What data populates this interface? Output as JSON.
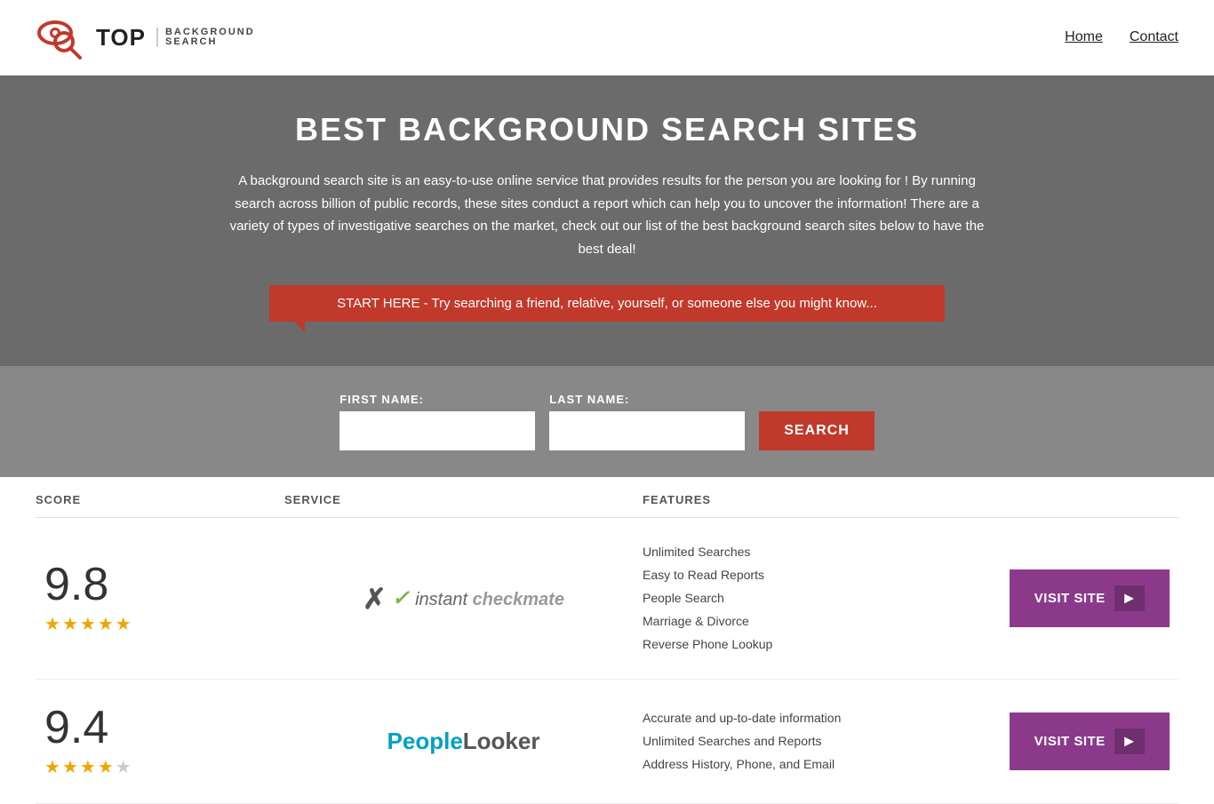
{
  "site": {
    "title": "Top Background Search"
  },
  "header": {
    "logo_top": "TOP",
    "logo_sub1": "BACKGROUND",
    "logo_sub2": "SEARCH",
    "nav": [
      {
        "label": "Home",
        "href": "#"
      },
      {
        "label": "Contact",
        "href": "#"
      }
    ]
  },
  "hero": {
    "title": "BEST BACKGROUND SEARCH SITES",
    "description": "A background search site is an easy-to-use online service that provides results  for the person you are looking for ! By  running  search across billion of public records, these sites conduct  a report which can help you to uncover the information! There are a variety of types of investigative searches on the market, check out our  list of the best background search sites below to have the best deal!",
    "cta_text": "START HERE - Try searching a friend, relative, yourself, or someone else you might know...",
    "first_name_label": "FIRST NAME:",
    "last_name_label": "LAST NAME:",
    "search_button": "SEARCH"
  },
  "table": {
    "headers": {
      "score": "SCORE",
      "service": "SERVICE",
      "features": "FEATURES",
      "action": ""
    },
    "rows": [
      {
        "score": "9.8",
        "stars": 4.5,
        "service_name": "Instant Checkmate",
        "service_type": "checkmate",
        "features": [
          "Unlimited Searches",
          "Easy to Read Reports",
          "People Search",
          "Marriage & Divorce",
          "Reverse Phone Lookup"
        ],
        "visit_label": "VISIT SITE"
      },
      {
        "score": "9.4",
        "stars": 4,
        "service_name": "PeopleLooker",
        "service_type": "peoplelooker",
        "features": [
          "Accurate and up-to-date information",
          "Unlimited Searches and Reports",
          "Address History, Phone, and Email"
        ],
        "visit_label": "VISIT SITE"
      }
    ]
  }
}
